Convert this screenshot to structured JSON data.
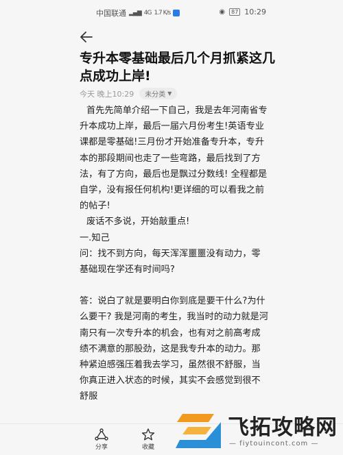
{
  "status_bar": {
    "carrier": "中国联通",
    "signal_text": "4G",
    "network_speed": "1.7 K/s",
    "battery": "87",
    "time": "10:29"
  },
  "note": {
    "title": "专升本零基础最后几个月抓紧这几点成功上岸!",
    "date": "今天 晚上10:29",
    "category": "未分类",
    "paragraphs": [
      "首先先简单介绍一下自己，我是去年河南省专升本成功上岸，最后一届六月份考生!英语专业课都是零基础!三月份才开始准备专升本，专升本的那段期间也走了一些弯路，最后找到了方法，有了方向，最后也是飘过分数线! 全程都是自学，没有报任何机构!更详细的可以看我之前的帖子!",
      "废话不多说，开始敲重点!",
      "一.知己",
      "问：找不到方向，每天浑浑噩噩没有动力，零基础现在学还有时间吗?",
      "",
      "答：说白了就是要明白你到底是要干什么?为什么要干? 我是河南的考生，我当时的动力就是河南只有一次专升本的机会，也有对之前高考成绩不满意的那股劲，这是我专升本的动力。那种紧迫感强压着我去学习，虽然很不舒服，当你真正进入状态的时候，其实不会感觉到很不舒服"
    ]
  },
  "bottom_bar": {
    "share_label": "分享",
    "favorite_label": "收藏"
  },
  "watermark": {
    "brand": "飞拓攻略网",
    "url": "— fiytouincont.com —"
  },
  "colors": {
    "background": "#f6f6f6",
    "logo_orange": "#f29a1f",
    "logo_blue": "#2a8fd6"
  }
}
